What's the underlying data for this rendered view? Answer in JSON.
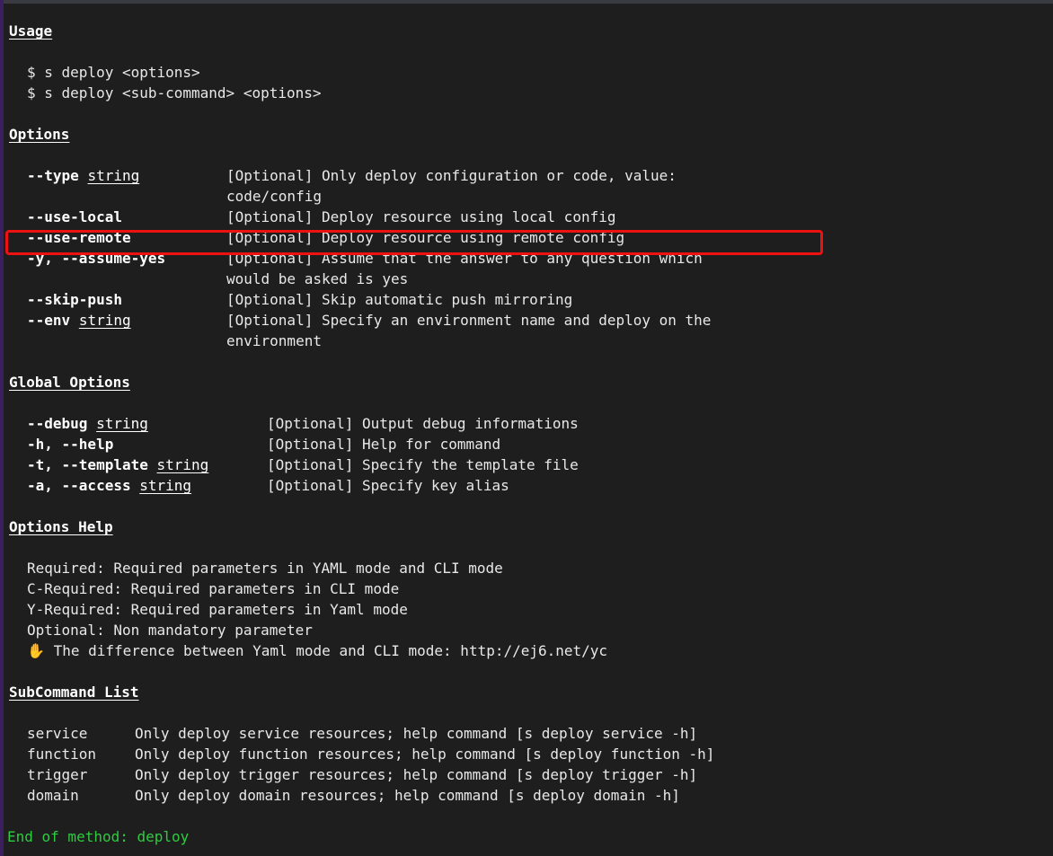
{
  "terminal": {
    "background": "#1e1e1e",
    "accent_stripe": "#3c1f5e",
    "highlight_color": "#ee1111",
    "end_color": "#2ecc40"
  },
  "usage": {
    "heading": "Usage",
    "lines": [
      "$ s deploy <options>",
      "$ s deploy <sub-command> <options>"
    ]
  },
  "options": {
    "heading": "Options",
    "items": [
      {
        "flag": "--type",
        "type": "string",
        "desc": "[Optional] Only deploy configuration or code, value:",
        "desc_cont": "code/config",
        "highlighted": false
      },
      {
        "flag": "--use-local",
        "type": "",
        "desc": "[Optional] Deploy resource using local config",
        "desc_cont": "",
        "highlighted": false
      },
      {
        "flag": "--use-remote",
        "type": "",
        "desc": "[Optional] Deploy resource using remote config",
        "desc_cont": "",
        "highlighted": true
      },
      {
        "flag": "-y, --assume-yes",
        "type": "",
        "desc": "[Optional] Assume that the answer to any question which",
        "desc_cont": "would be asked is yes",
        "highlighted": false
      },
      {
        "flag": "--skip-push",
        "type": "",
        "desc": "[Optional] Skip automatic push mirroring",
        "desc_cont": "",
        "highlighted": false
      },
      {
        "flag": "--env",
        "type": "string",
        "desc": "[Optional] Specify an environment name and deploy on the",
        "desc_cont": "environment",
        "highlighted": false
      }
    ]
  },
  "global_options": {
    "heading": "Global Options",
    "items": [
      {
        "flag": "--debug",
        "type": "string",
        "desc": "[Optional] Output debug informations"
      },
      {
        "flag": "-h, --help",
        "type": "",
        "desc": "[Optional] Help for command"
      },
      {
        "flag": "-t, --template",
        "type": "string",
        "desc": "[Optional] Specify the template file"
      },
      {
        "flag": "-a, --access",
        "type": "string",
        "desc": "[Optional] Specify key alias"
      }
    ]
  },
  "options_help": {
    "heading": "Options Help",
    "lines": [
      "Required: Required parameters in YAML mode and CLI mode",
      "C-Required: Required parameters in CLI mode",
      "Y-Required: Required parameters in Yaml mode",
      "Optional: Non mandatory parameter"
    ],
    "note_icon": "✋",
    "note": "The difference between Yaml mode and CLI mode: http://ej6.net/yc"
  },
  "subcommand_list": {
    "heading": "SubCommand List",
    "items": [
      {
        "name": "service",
        "desc": "Only deploy service resources; help command [s deploy service -h]"
      },
      {
        "name": "function",
        "desc": "Only deploy function resources; help command [s deploy function -h]"
      },
      {
        "name": "trigger",
        "desc": "Only deploy trigger resources; help command [s deploy trigger -h]"
      },
      {
        "name": "domain",
        "desc": "Only deploy domain resources; help command [s deploy domain -h]"
      }
    ]
  },
  "footer": {
    "end_message": "End of method: deploy"
  }
}
